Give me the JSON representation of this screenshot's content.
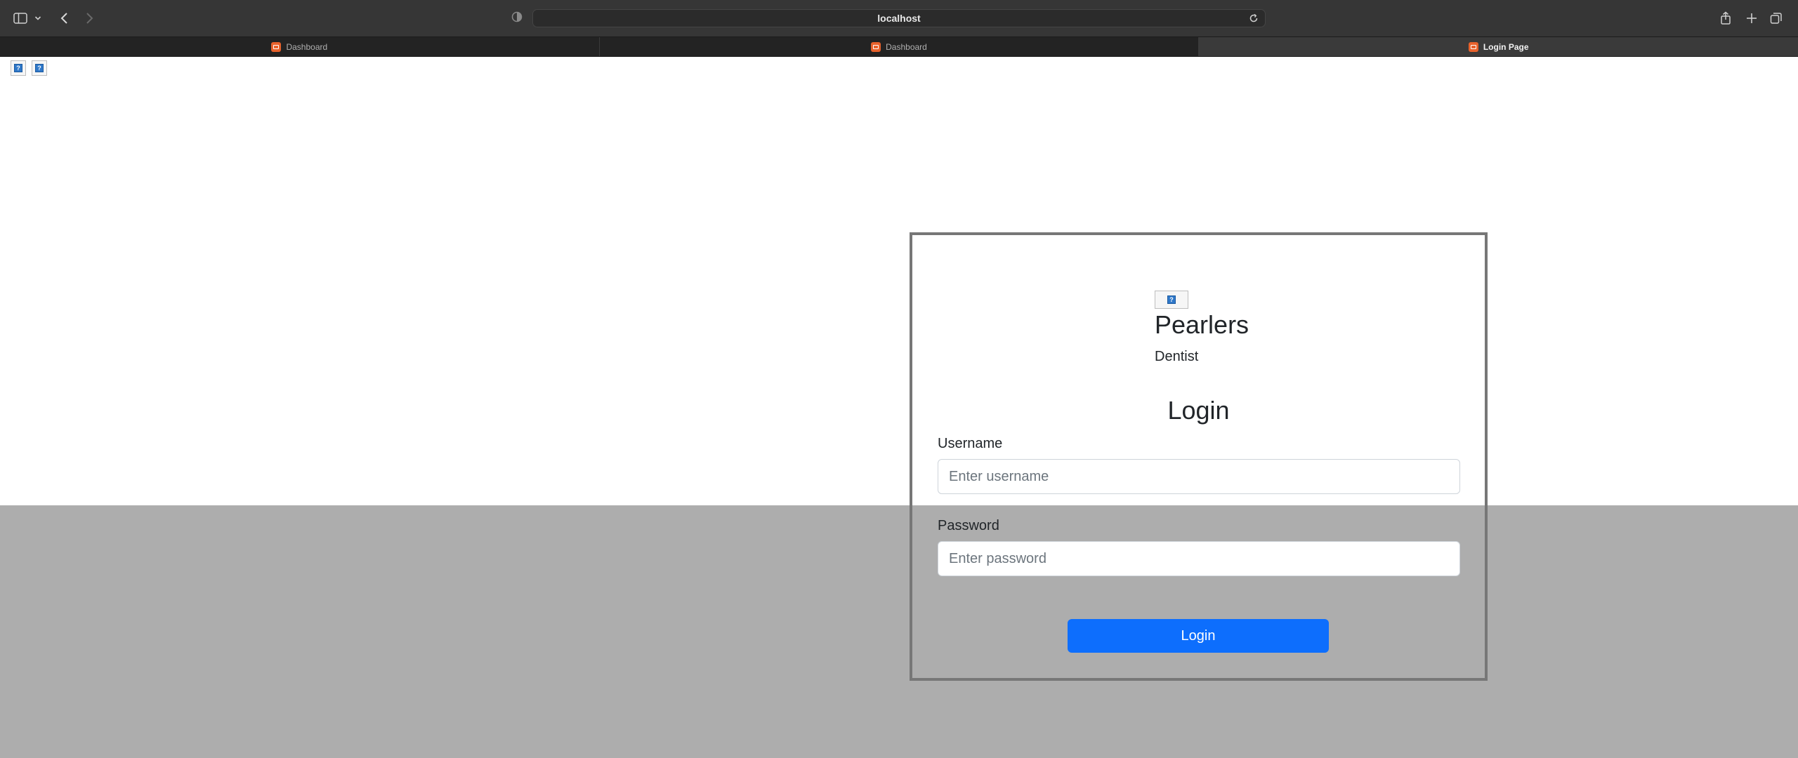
{
  "browser": {
    "address": "localhost",
    "tabs": [
      {
        "label": "Dashboard",
        "active": false
      },
      {
        "label": "Dashboard",
        "active": false
      },
      {
        "label": "Login Page",
        "active": true
      }
    ],
    "icons": [
      "sidebar-icon",
      "chevron-down-icon",
      "back-arrow-icon",
      "forward-arrow-icon",
      "privacy-shield-icon",
      "reload-icon",
      "share-icon",
      "new-tab-plus-icon",
      "tab-overview-icon"
    ]
  },
  "page": {
    "brand": {
      "name": "Pearlers",
      "subtitle": "Dentist"
    },
    "login": {
      "title": "Login",
      "username_label": "Username",
      "username_placeholder": "Enter username",
      "password_label": "Password",
      "password_placeholder": "Enter password",
      "submit_label": "Login"
    }
  },
  "colors": {
    "primary_button": "#0d6efd",
    "overlay_gray": "#adadad",
    "card_border": "#777777",
    "tab_favicon": "#e8622c"
  }
}
